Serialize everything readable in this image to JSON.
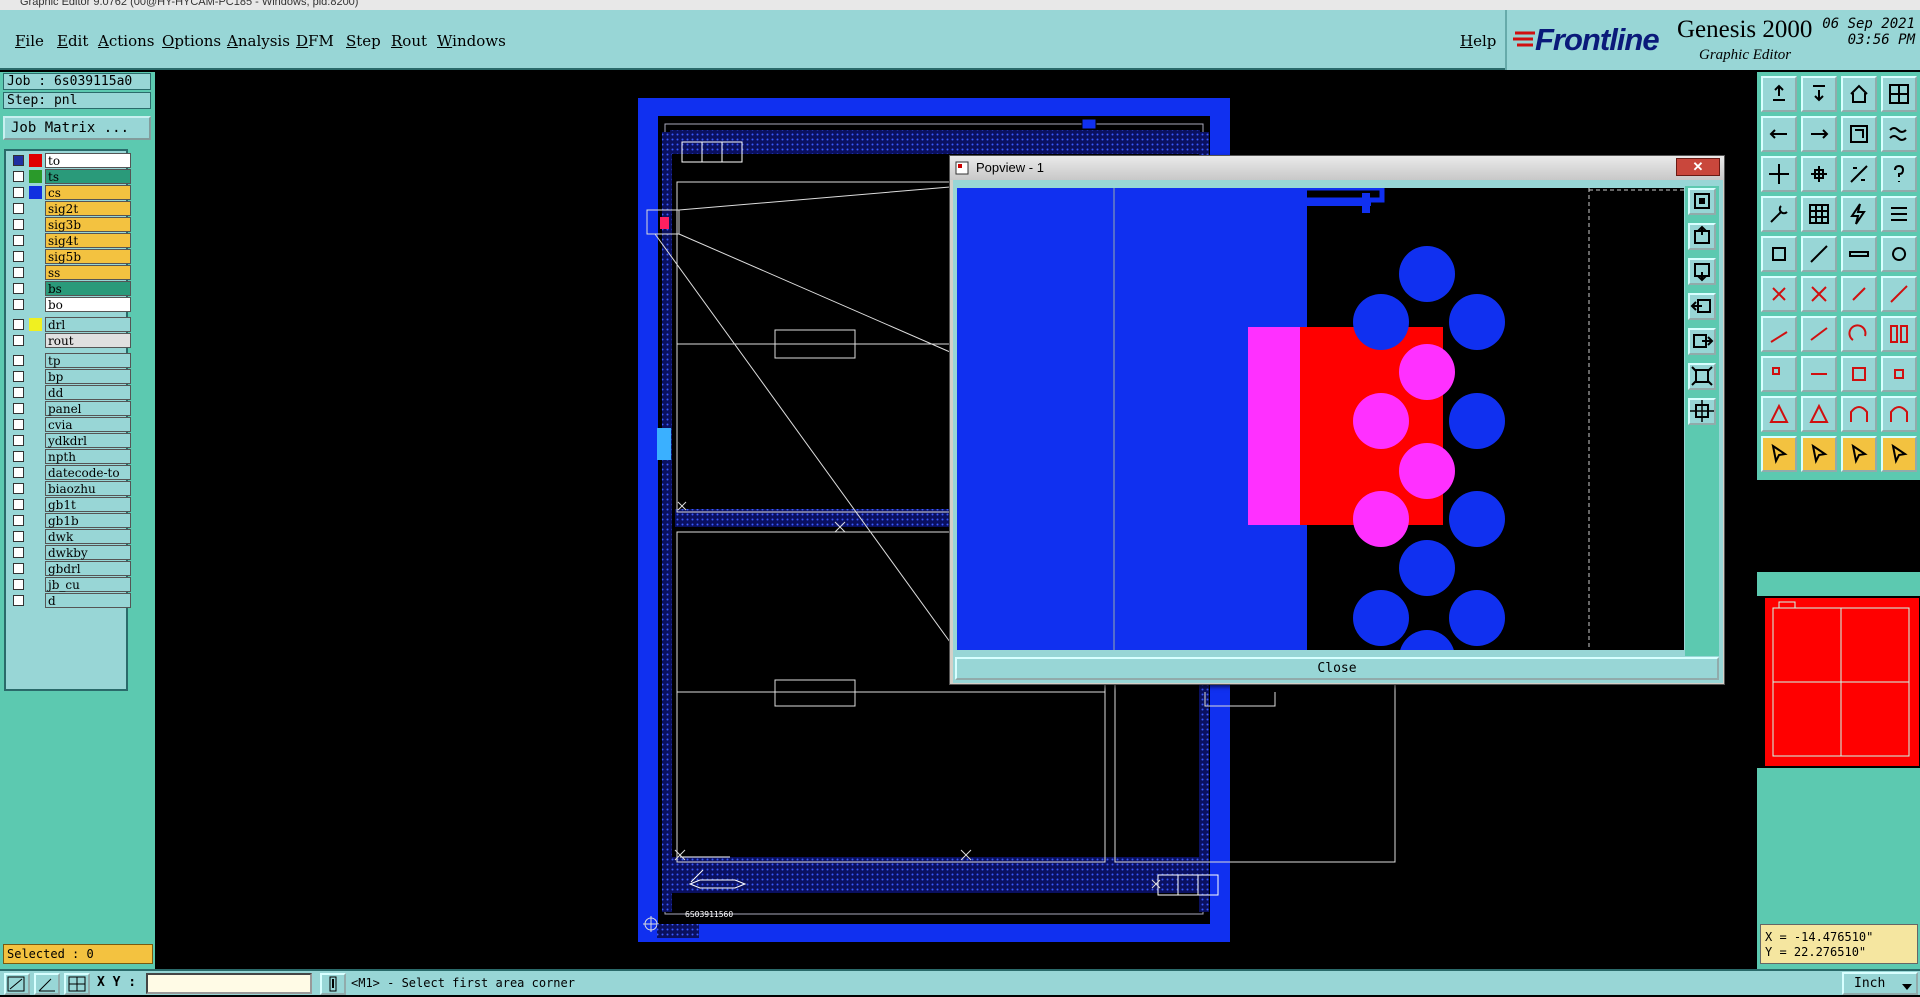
{
  "window": {
    "title": "Graphic Editor 9.0762 (00@HY-HYCAM-PC185 - Windows, pid:8200)"
  },
  "menu": [
    "File",
    "Edit",
    "Actions",
    "Options",
    "Analysis",
    "DFM",
    "Step",
    "Rout",
    "Windows"
  ],
  "help": "Help",
  "brand": {
    "logo": "Frontline",
    "app": "Genesis 2000",
    "sub": "Graphic Editor",
    "date": "06 Sep 2021",
    "time": "03:56 PM"
  },
  "job": {
    "job_label": "Job : 6s039115a0",
    "step_label": "Step: pnl",
    "matrix_button": "Job Matrix ..."
  },
  "layers": [
    {
      "name": "to",
      "color": "#e00000",
      "bg": "#ffffff",
      "checked": true
    },
    {
      "name": "ts",
      "color": "#2a9a2a",
      "bg": "#2a9a7a",
      "checked": false
    },
    {
      "name": "cs",
      "color": "#1030e0",
      "bg": "#f3c240",
      "checked": false
    },
    {
      "name": "sig2t",
      "color": "",
      "bg": "#f3c240",
      "checked": false
    },
    {
      "name": "sig3b",
      "color": "",
      "bg": "#f3c240",
      "checked": false
    },
    {
      "name": "sig4t",
      "color": "",
      "bg": "#f3c240",
      "checked": false
    },
    {
      "name": "sig5b",
      "color": "",
      "bg": "#f3c240",
      "checked": false
    },
    {
      "name": "ss",
      "color": "",
      "bg": "#f3c240",
      "checked": false
    },
    {
      "name": "bs",
      "color": "",
      "bg": "#2a9a7a",
      "checked": false
    },
    {
      "name": "bo",
      "color": "",
      "bg": "#ffffff",
      "checked": false
    },
    {
      "name": "drl",
      "color": "#f0f020",
      "bg": "#98d6d6",
      "checked": false
    },
    {
      "name": "rout",
      "color": "",
      "bg": "#e0e0e0",
      "checked": false
    },
    {
      "name": "tp",
      "color": "",
      "bg": "#98d6d6",
      "checked": false
    },
    {
      "name": "bp",
      "color": "",
      "bg": "#98d6d6",
      "checked": false
    },
    {
      "name": "dd",
      "color": "",
      "bg": "#98d6d6",
      "checked": false
    },
    {
      "name": "panel",
      "color": "",
      "bg": "#98d6d6",
      "checked": false
    },
    {
      "name": "cvia",
      "color": "",
      "bg": "#98d6d6",
      "checked": false
    },
    {
      "name": "ydkdrl",
      "color": "",
      "bg": "#98d6d6",
      "checked": false
    },
    {
      "name": "npth",
      "color": "",
      "bg": "#98d6d6",
      "checked": false
    },
    {
      "name": "datecode-to",
      "color": "",
      "bg": "#98d6d6",
      "checked": false
    },
    {
      "name": "biaozhu",
      "color": "",
      "bg": "#98d6d6",
      "checked": false
    },
    {
      "name": "gb1t",
      "color": "",
      "bg": "#98d6d6",
      "checked": false
    },
    {
      "name": "gb1b",
      "color": "",
      "bg": "#98d6d6",
      "checked": false
    },
    {
      "name": "dwk",
      "color": "",
      "bg": "#98d6d6",
      "checked": false
    },
    {
      "name": "dwkby",
      "color": "",
      "bg": "#98d6d6",
      "checked": false
    },
    {
      "name": "gbdrl",
      "color": "",
      "bg": "#98d6d6",
      "checked": false
    },
    {
      "name": "jb_cu",
      "color": "",
      "bg": "#98d6d6",
      "checked": false
    },
    {
      "name": "d",
      "color": "",
      "bg": "#98d6d6",
      "checked": false
    }
  ],
  "selected": "Selected : 0",
  "coords": {
    "x": "X = -14.476510\"",
    "y": "Y = 22.276510\""
  },
  "status": {
    "xy_label": "X Y :",
    "xy_value": "",
    "prompt": "<M1> - Select first area corner",
    "units": "Inch"
  },
  "popview": {
    "title": "Popview - 1",
    "close_x": "✕",
    "close_button": "Close"
  },
  "colors": {
    "board_blue": "#1030f0",
    "layer_red": "#ff0000",
    "highlight_magenta": "#ff30ff",
    "panel_teal": "#5cc9b0",
    "menu_teal": "#98d6d6"
  },
  "board": {
    "serial": "6S03911560"
  }
}
